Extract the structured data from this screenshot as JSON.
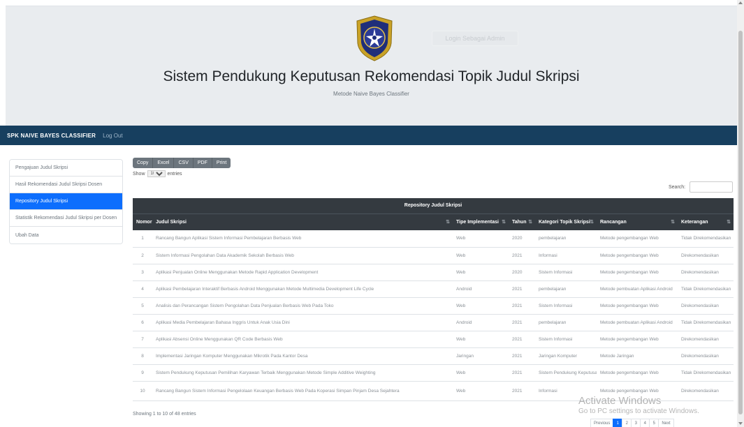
{
  "header": {
    "title": "Sistem Pendukung Keputusan Rekomendasi Topik Judul Skripsi",
    "subtitle": "Metode Naive Bayes Classifier",
    "login_label": "Login Sebagai Admin",
    "logo_icon": "university-seal-icon"
  },
  "navbar": {
    "brand": "SPK NAIVE BAYES CLASSIFIER",
    "link": "Log Out",
    "color": "#173f5f"
  },
  "sidebar": {
    "items": [
      {
        "label": "Pengajuan Judul Skripsi"
      },
      {
        "label": "Hasil Rekomendasi Judul Skripsi Dosen"
      },
      {
        "label": "Repository Judul Skripsi"
      },
      {
        "label": "Statistik Rekomendasi Judul Skripsi per Dosen"
      },
      {
        "label": "Ubah Data"
      }
    ],
    "active_index": 2,
    "accent": "#0d6efd"
  },
  "toolbar": {
    "copy": "Copy",
    "excel": "Excel",
    "csv": "CSV",
    "pdf": "PDF",
    "print": "Print"
  },
  "table_controls": {
    "show_label": "Show",
    "entries_value": "10",
    "entries_label": "entries",
    "search_label": "Search:"
  },
  "table": {
    "caption": "Repository Judul Skripsi",
    "columns": [
      "Nomor",
      "Judul Skripsi",
      "Tipe Implementasi",
      "Tahun",
      "Kategori Topik Skripsi",
      "Rancangan",
      "Keterangan"
    ],
    "rows": [
      [
        "1",
        "Rancang Bangun Aplikasi Sistem Informasi Pembelajaran Berbasis Web",
        "Web",
        "2020",
        "pembelajaran",
        "Metode pengembangan Web",
        "Tidak Direkomendasikan"
      ],
      [
        "2",
        "Sistem Informasi Pengolahan Data Akademik Sekolah Berbasis Web",
        "Web",
        "2021",
        "Informasi",
        "Metode pengembangan Web",
        "Direkomendasikan"
      ],
      [
        "3",
        "Aplikasi Penjualan Online Menggunakan Metode Rapid Application Development",
        "Web",
        "2020",
        "Sistem Informasi",
        "Metode pengembangan Web",
        "Direkomendasikan"
      ],
      [
        "4",
        "Aplikasi Pembelajaran Interaktif Berbasis Android Menggunakan Metode Multimedia Development Life Cycle",
        "Android",
        "2021",
        "pembelajaran",
        "Metode pembuatan Aplikasi Android",
        "Tidak Direkomendasikan"
      ],
      [
        "5",
        "Analisis dan Perancangan Sistem Pengolahan Data Penjualan Berbasis Web Pada Toko",
        "Web",
        "2021",
        "Sistem Informasi",
        "Metode pengembangan Web",
        "Direkomendasikan"
      ],
      [
        "6",
        "Aplikasi Media Pembelajaran Bahasa Inggris Untuk Anak Usia Dini",
        "Android",
        "2021",
        "pembelajaran",
        "Metode pembuatan Aplikasi Android",
        "Tidak Direkomendasikan"
      ],
      [
        "7",
        "Aplikasi Absensi Online Menggunakan QR Code Berbasis Web",
        "Web",
        "2021",
        "Sistem Informasi",
        "Metode pengembangan Web",
        "Direkomendasikan"
      ],
      [
        "8",
        "Implementasi Jaringan Komputer Menggunakan Mikrotik Pada Kantor Desa",
        "Jaringan",
        "2021",
        "Jaringan Komputer",
        "Metode Jaringan",
        "Direkomendasikan"
      ],
      [
        "9",
        "Sistem Pendukung Keputusan Pemilihan Karyawan Terbaik Menggunakan Metode Simple Additive Weighting",
        "Web",
        "2021",
        "Sistem Pendukung Keputusan",
        "Metode pengembangan Web",
        "Tidak Direkomendasikan"
      ],
      [
        "10",
        "Rancang Bangun Sistem Informasi Pengelolaan Keuangan Berbasis Web Pada Koperasi Simpan Pinjam Desa Sejahtera",
        "Web",
        "2021",
        "Informasi",
        "Metode pengembangan Web",
        "Direkomendasikan"
      ]
    ]
  },
  "footer": {
    "info": "Showing 1 to 10 of 48 entries",
    "pagination": [
      "Previous",
      "1",
      "2",
      "3",
      "4",
      "5",
      "Next"
    ],
    "active_page": "1"
  },
  "watermark": {
    "line1": "Activate Windows",
    "line2": "Go to PC settings to activate Windows."
  }
}
